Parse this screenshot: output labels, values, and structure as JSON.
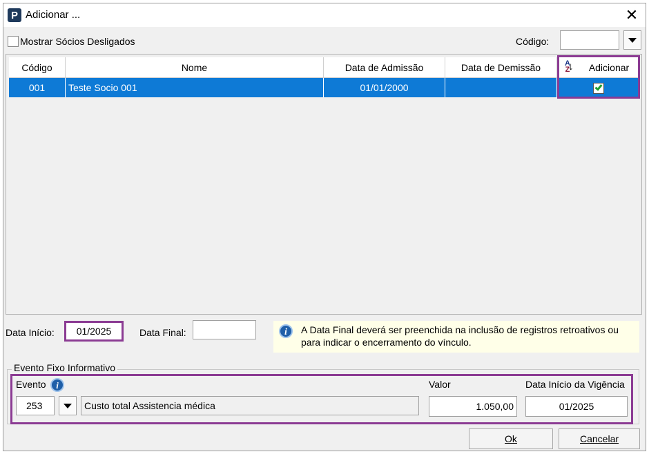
{
  "window": {
    "title": "Adicionar ..."
  },
  "filters": {
    "show_dismissed_label": "Mostrar Sócios Desligados",
    "show_dismissed_checked": false,
    "code_label": "Código:",
    "code_value": ""
  },
  "grid": {
    "columns": [
      "Código",
      "Nome",
      "Data de Admissão",
      "Data de Demissão",
      "Adicionar"
    ],
    "rows": [
      {
        "codigo": "001",
        "nome": "Teste Socio 001",
        "admissao": "01/01/2000",
        "demissao": "",
        "adicionar": true
      }
    ]
  },
  "dates": {
    "start_label": "Data Início:",
    "start_value": "01/2025",
    "end_label": "Data Final:",
    "end_value": ""
  },
  "note": {
    "text": "A Data Final deverá ser preenchida na inclusão de registros retroativos ou para indicar o encerramento do vínculo."
  },
  "event_group": {
    "title": "Evento Fixo Informativo",
    "event_label": "Evento",
    "event_code": "253",
    "event_description": "Custo total Assistencia médica",
    "value_label": "Valor",
    "value": "1.050,00",
    "validity_label": "Data Início da Vigência",
    "validity_value": "01/2025"
  },
  "buttons": {
    "ok": "Ok",
    "cancel": "Cancelar"
  },
  "colors": {
    "selection": "#0e7ad6",
    "highlight_box": "#8b3b93",
    "note_bg": "#ffffe8"
  }
}
